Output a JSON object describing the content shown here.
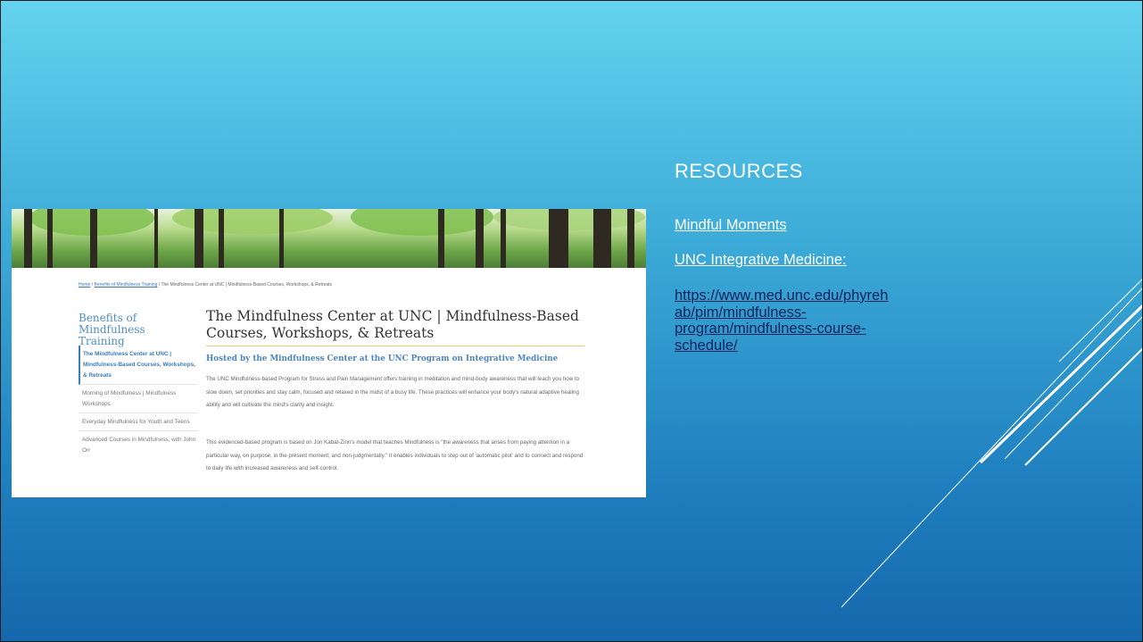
{
  "heading": "RESOURCES",
  "links": {
    "mindful": "Mindful Moments",
    "unc": "UNC Integrative Medicine:",
    "url_line1": "https://www.med.unc.edu/phyreh",
    "url_line2": "ab/pim/mindfulness-",
    "url_line3": "program/mindfulness-course-",
    "url_line4": "schedule/"
  },
  "screenshot": {
    "breadcrumb_home": "Home",
    "breadcrumb_sep": " / ",
    "breadcrumb_benefits": "Benefits of Mindfulness Training",
    "breadcrumb_current": "The Mindfulness Center at UNC | Mindfulness-Based Courses, Workshops, & Retreats",
    "sidebar_title": "Benefits of Mindfulness Training",
    "sidebar_items": [
      "The Mindfulness Center at UNC | Mindfulness-Based Courses, Workshops, & Retreats",
      "Morning of Mindfulness | Mindfulness Workshops",
      "Everyday Mindfulness for Youth and Teens",
      "Advanced Courses in Mindfulness, with John Orr"
    ],
    "main_title": "The Mindfulness Center at UNC | Mindfulness-Based Courses, Workshops, & Retreats",
    "subheading": "Hosted by the Mindfulness Center at the UNC Program on Integrative Medicine",
    "para1": "The UNC Mindfulness-based Program for Stress and Pain Management offers training in meditation and mind-body awareness that will teach you how to slow down, set priorities and stay calm, focused and relaxed in the midst of a busy life. These practices will enhance your body's natural adaptive healing ability and will cultivate the mind's clarity and insight.",
    "para2": "This evidenced-based program is based on Jon Kabat-Zinn's model that teaches Mindfulness is \"the awareness that arises from paying attention in a particular way, on purpose, in the present moment, and non-judgmentally.\" It enables individuals to step out of 'automatic pilot' and to connect and respond to daily life with increased awareness and self-control."
  },
  "colors": {
    "background_top": "#63d3ef",
    "background_bottom": "#1568ab",
    "link_dark": "#14225a",
    "accent_blue": "#4b86bf"
  }
}
